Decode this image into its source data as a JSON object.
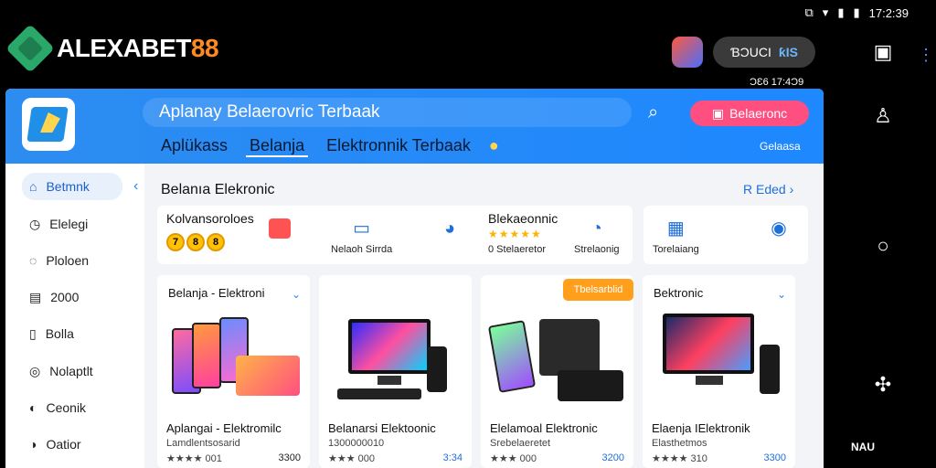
{
  "status": {
    "time": "17:2:39"
  },
  "brand": {
    "name_part1": "ALEXABET",
    "name_part2": "88"
  },
  "topbar": {
    "pill_text": "ƁƆUCI",
    "pill_badge": "ƙIS",
    "clock2": "ƆƐ6 17:4Ɔ9"
  },
  "header": {
    "title": "Aplanay Belaerovric Terbaak",
    "cta": "Belaeronc",
    "tabs": [
      "Aplükass",
      "Belanja",
      "Elektronnik Terbaak"
    ],
    "right_label": "Gelaasa"
  },
  "sidebar": {
    "items": [
      {
        "label": "Betmnk",
        "icon": "home-icon"
      },
      {
        "label": "Elelegi",
        "icon": "clock-icon"
      },
      {
        "label": "Ploloen",
        "icon": "chat-icon"
      },
      {
        "label": "2000",
        "icon": "gallery-icon"
      },
      {
        "label": "Bolla",
        "icon": "ball-icon"
      },
      {
        "label": "Nolaptlt",
        "icon": "laptop-icon"
      },
      {
        "label": "Ceonik",
        "icon": "electronics-icon"
      },
      {
        "label": "Oatior",
        "icon": "settings-icon"
      }
    ]
  },
  "main": {
    "section_title": "Belanıa Elekronic",
    "see_all": "R Eded",
    "row1": {
      "title": "Kolvansoroloes",
      "coins": [
        "7",
        "8",
        "8"
      ],
      "cats": [
        {
          "label": "Nelaoh Sirrda",
          "icon": "monitor-icon"
        },
        {
          "label": "",
          "icon": "compass-icon"
        }
      ]
    },
    "row2": {
      "title": "Blekaeonnic",
      "sub": "0 Stelaeretor",
      "cats": [
        {
          "label": "Strelaonig",
          "icon": "drive-icon"
        }
      ]
    },
    "row3": {
      "cats": [
        {
          "label": "Torelaiang",
          "icon": "gallery-icon"
        },
        {
          "label": "",
          "icon": "target-icon"
        }
      ]
    },
    "badge": "Tbelsarblid",
    "cards": [
      {
        "title": "Belanja - Elektroni",
        "name": "Aplangai - Elektromilc",
        "sub": "Lamdlentsosarid",
        "rating": "★★★★ 001",
        "price": "3300"
      },
      {
        "title": "",
        "name": "Belanarsi Elektoonic",
        "sub": "1300000010",
        "rating": "★★★ 000",
        "price": "3:34"
      },
      {
        "title": "",
        "name": "Elelamoal Elektronic",
        "sub": "Srebelaeretet",
        "rating": "★★★ 000",
        "price": "3200"
      },
      {
        "title": "Bektronic",
        "name": "Elaenja IElektronik",
        "sub": "Elasthetmos",
        "rating": "★★★★ 310",
        "price": "3300"
      }
    ]
  },
  "rail": {
    "label": "NAU"
  }
}
